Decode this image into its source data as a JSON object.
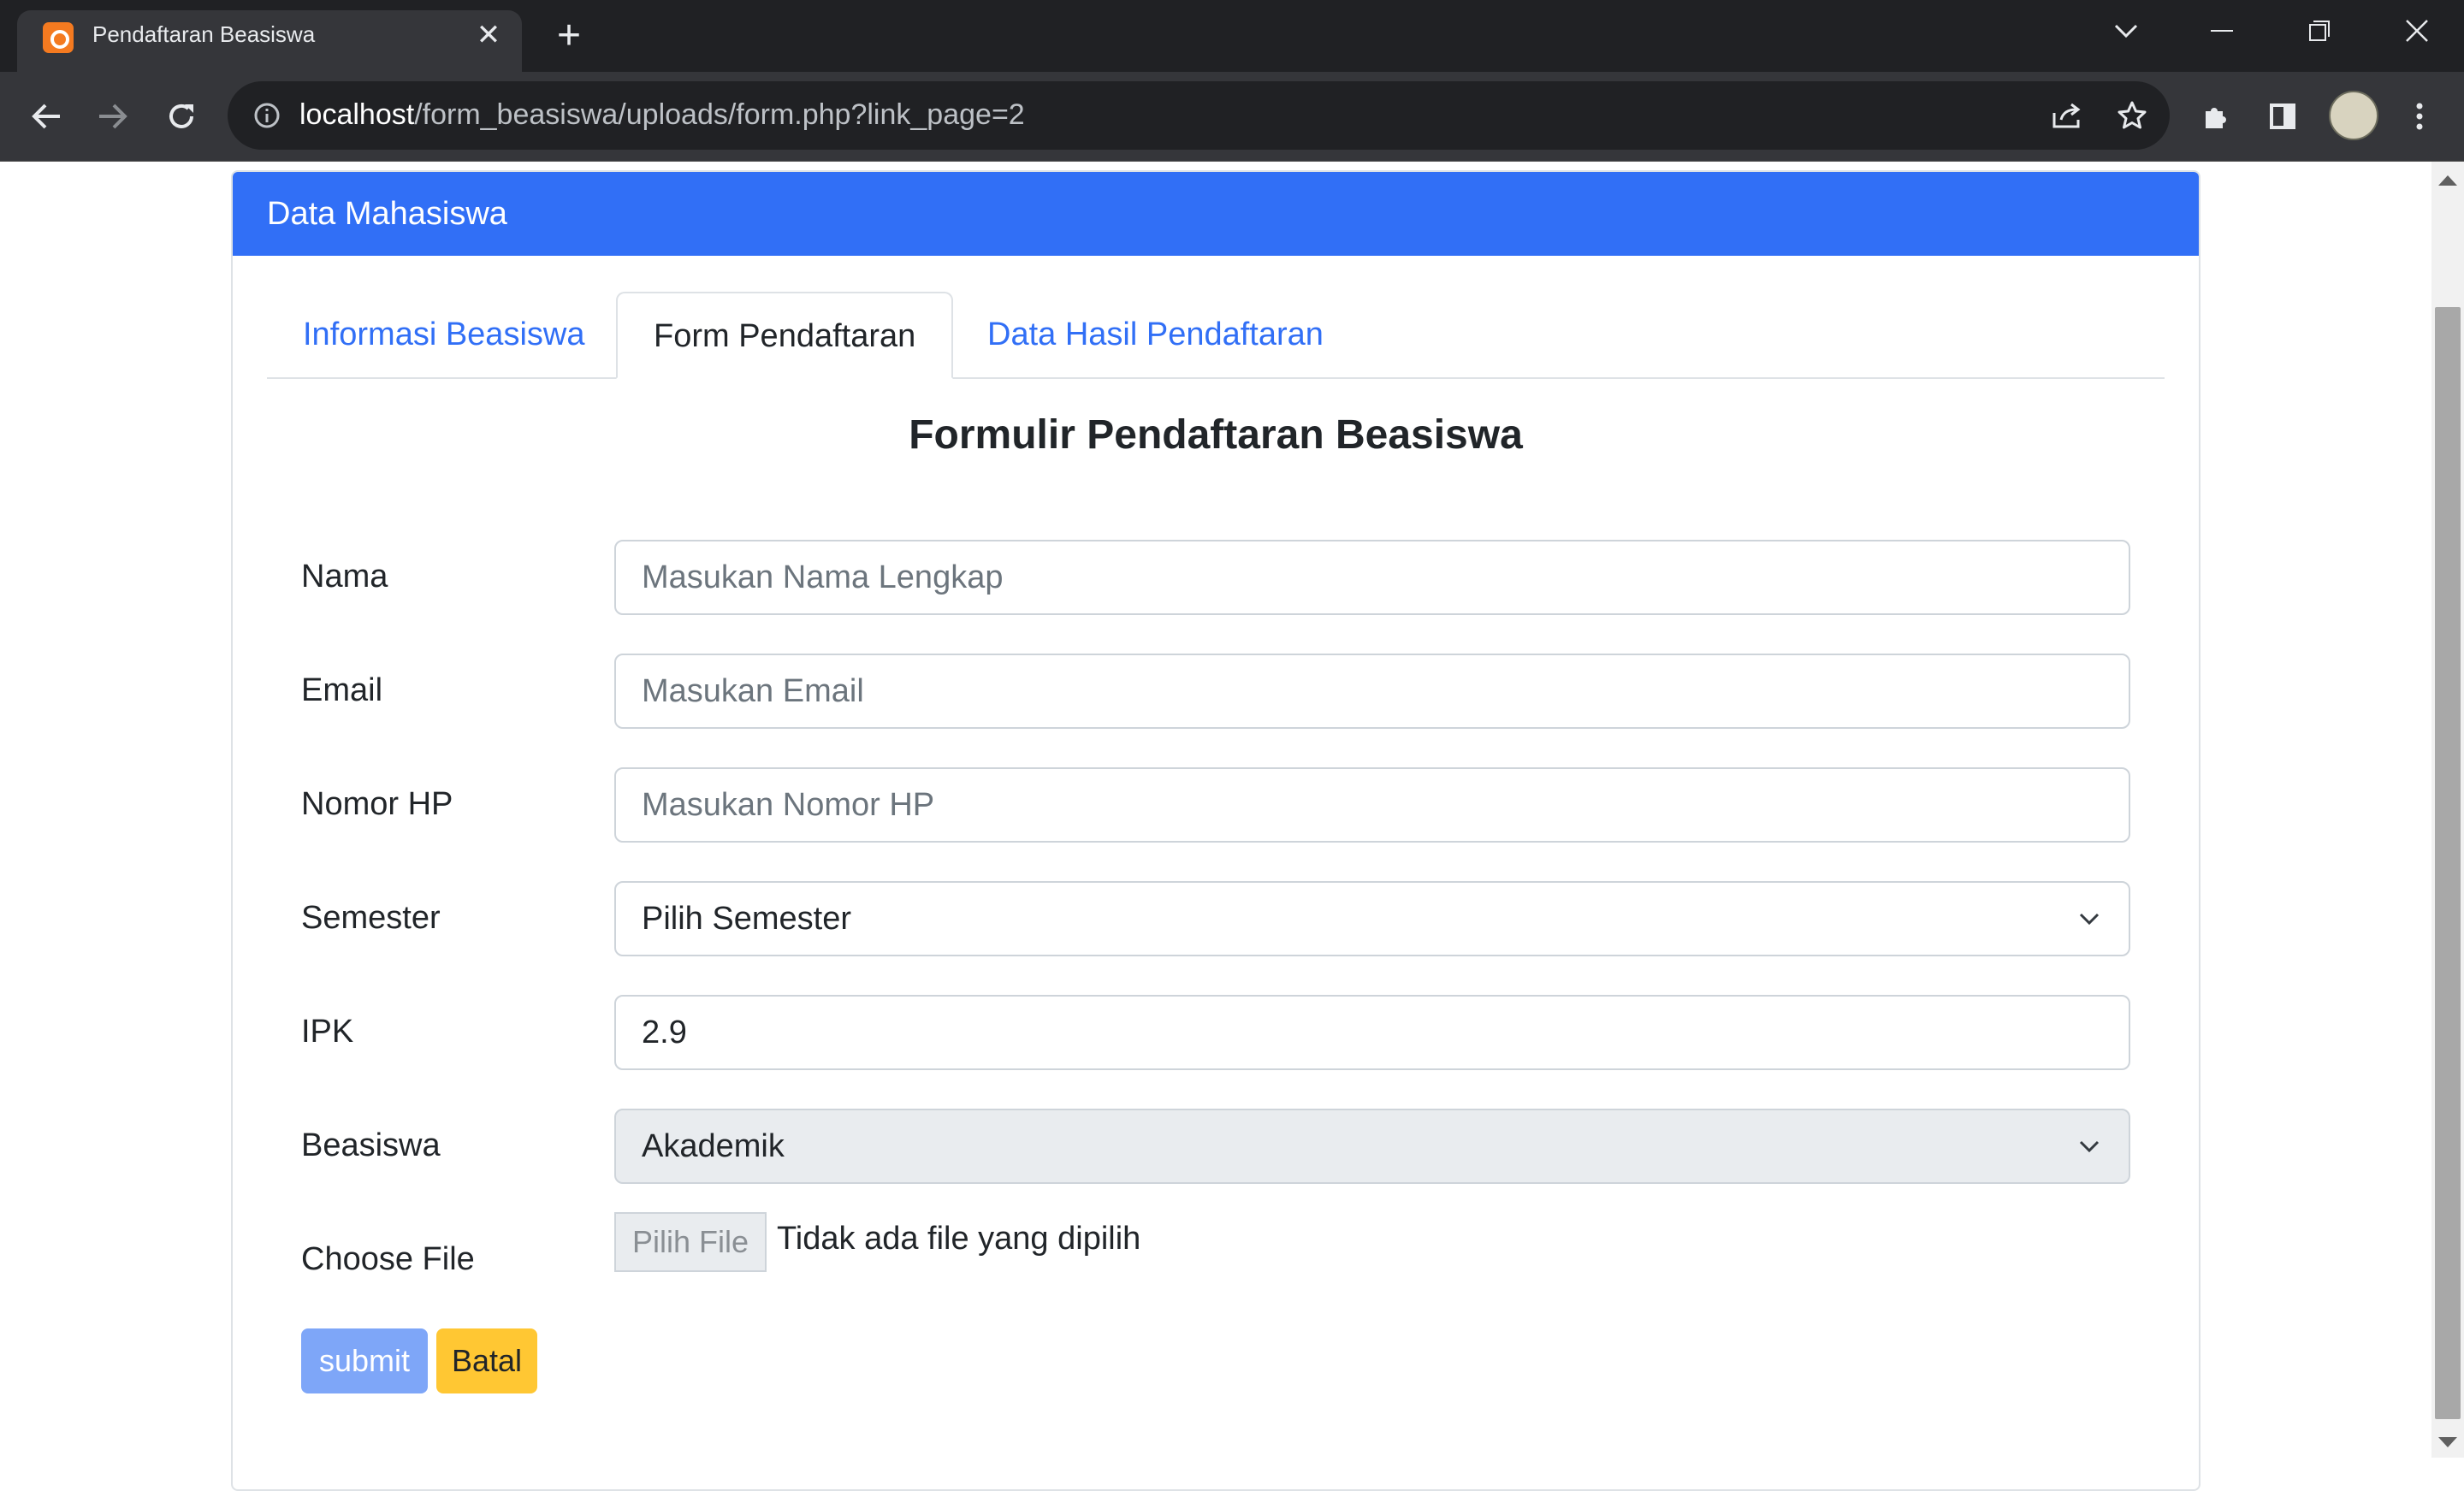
{
  "browser": {
    "tab_title": "Pendaftaran Beasiswa",
    "url_host": "localhost",
    "url_path": "/form_beasiswa/uploads/form.php?link_page=2"
  },
  "card": {
    "header": "Data Mahasiswa",
    "tabs": [
      {
        "label": "Informasi Beasiswa",
        "active": false
      },
      {
        "label": "Form Pendaftaran",
        "active": true
      },
      {
        "label": "Data Hasil Pendaftaran",
        "active": false
      }
    ]
  },
  "form": {
    "title": "Formulir Pendaftaran Beasiswa",
    "nama": {
      "label": "Nama",
      "placeholder": "Masukan Nama Lengkap"
    },
    "email": {
      "label": "Email",
      "placeholder": "Masukan Email"
    },
    "nomor_hp": {
      "label": "Nomor HP",
      "placeholder": "Masukan Nomor HP"
    },
    "semester": {
      "label": "Semester",
      "value": "Pilih Semester"
    },
    "ipk": {
      "label": "IPK",
      "value": "2.9"
    },
    "beasiswa": {
      "label": "Beasiswa",
      "value": "Akademik"
    },
    "file": {
      "label": "Choose File",
      "button": "Pilih File",
      "status": "Tidak ada file yang dipilih"
    },
    "submit_label": "submit",
    "cancel_label": "Batal"
  },
  "colors": {
    "header_bg": "#316ff6",
    "link": "#316ff6",
    "submit_bg": "#7ea6f8",
    "batal_bg": "#ffc733"
  }
}
